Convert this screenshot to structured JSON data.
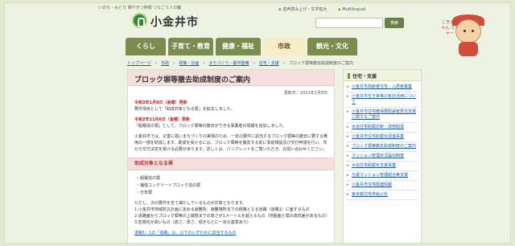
{
  "header": {
    "tagline": "いのち・みどり 輝やきつ笑顔 つなごう人の輪",
    "city_name": "小金井市",
    "utility_links": [
      "音声読み上げ・文字拡大",
      "Multilingual"
    ],
    "search_placeholder": "",
    "search_button": "検索"
  },
  "nav": {
    "items": [
      "くらし",
      "子育て・教育",
      "健康・福祉",
      "市政",
      "観光・文化"
    ],
    "active_index": 3
  },
  "mascot": {
    "label": "こきんちゃん コーナー"
  },
  "breadcrumb": [
    "トップページ",
    "市政",
    "政策・計画",
    "まちづくり・都市整備",
    "住宅・支援",
    "ブロック塀等撤去助成制度のご案内"
  ],
  "main": {
    "title": "ブロック塀等撤去助成制度のご案内",
    "updated": "更新日：2021年1月8日",
    "notice1_date": "令和3年1月8日（金曜）更新",
    "notice1_text": "要件項目として「助成対象となる塀」を拡充しました。",
    "notice2_date": "令和2年11月6日（金曜）更新",
    "notice2_text": "「組積造の塀」として、ブロック塀等の撤去ができる事業者の情報を追加しました。",
    "intro": "小金井市では、災害に強いまちづくりの実現のため、一定の要件に該当するブロック塀等の撤去に要する費用の一部を助成します。助成を受けるには、ブロック塀等を撤去する前に事前相談及び交付申請を行い、市から交付決定を受ける必要があります。詳しくは、パンフレットをご覧いただき、お問い合わせください。",
    "section_heading": "助成対象となる塀",
    "wall_types": [
      "組積造の塀",
      "補強コンクリートブロック造の塀",
      "万年塀"
    ],
    "conditions_intro": "ただし、次の要件を全て満たしているものが対象となります。",
    "conditions": [
      "1.小金井市地域防災計画に定める避難所、避難場所までの経路となる道路（道路1）に面するもの",
      "2.道路面からブロック塀等の上端部までの高さが1メートルを超えるもの（地盤面と塀の高低差があるもの）",
      "3.危険性が高いもの（高さ、厚さ、傾きなどに一定の基準あり）"
    ],
    "footnote": "道路1：1の「道路」は、以下のいずれかに該当するもの"
  },
  "sidebar": {
    "heading": "住宅・支援",
    "links": [
      "小金井市高齢者住宅・入居者募集",
      "小金井市空き家等の有効活用について",
      "小金井市住宅確保要配慮者居住支援に関するご案内",
      "木造住宅耐震診断・改修助成",
      "小金井市住宅耐震化促進事業",
      "ブロック塀等撤去助成制度のご案内",
      "マンション管理状況届出制度",
      "木造住宅耐震化支援事業",
      "分譲マンション管理組合等支援",
      "小金井市住宅関連情報",
      "東京都住宅供給公社"
    ]
  }
}
